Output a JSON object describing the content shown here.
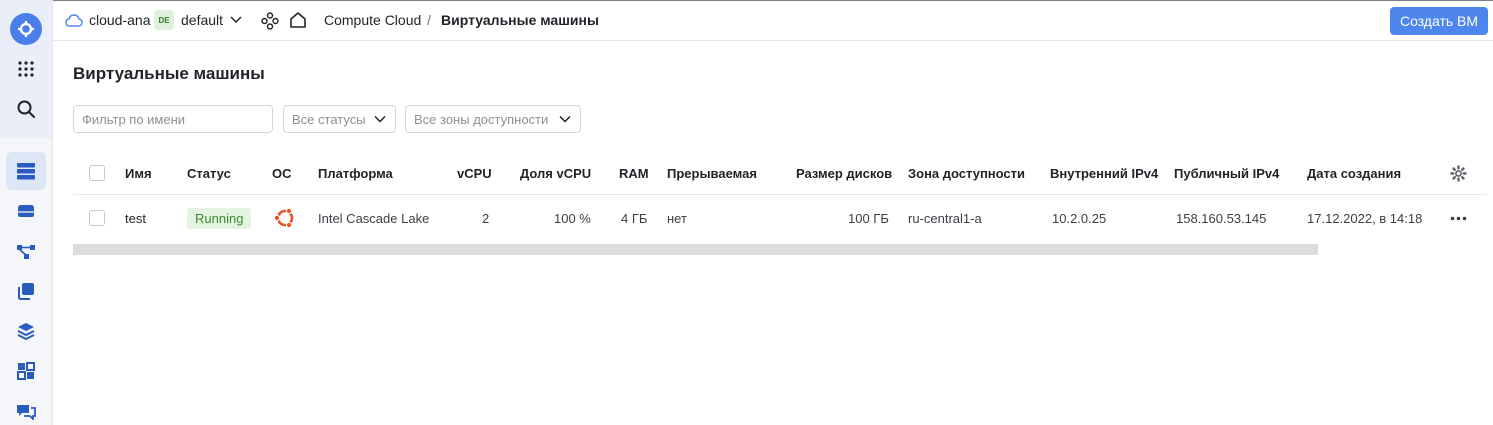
{
  "header": {
    "cloud": "cloud-ana",
    "folder_badge": "DE",
    "folder": "default",
    "service": "Compute Cloud",
    "separator": "/",
    "section": "Виртуальные машины",
    "create_button": "Создать ВМ"
  },
  "page": {
    "title": "Виртуальные машины"
  },
  "filters": {
    "name_placeholder": "Фильтр по имени",
    "status_select": "Все статусы",
    "zone_select": "Все зоны доступности"
  },
  "table": {
    "columns": [
      "Имя",
      "Статус",
      "ОС",
      "Платформа",
      "vCPU",
      "Доля vCPU",
      "RAM",
      "Прерываемая",
      "Размер дисков",
      "Зона доступности",
      "Внутренний IPv4",
      "Публичный IPv4",
      "Дата создания"
    ],
    "rows": [
      {
        "name": "test",
        "status": "Running",
        "os_icon": "ubuntu-icon",
        "platform": "Intel Cascade Lake",
        "vcpu": "2",
        "vcpu_share": "100 %",
        "ram": "4 ГБ",
        "preemptible": "нет",
        "disk_size": "100 ГБ",
        "zone": "ru-central1-a",
        "internal_ip": "10.2.0.25",
        "public_ip": "158.160.53.145",
        "created": "17.12.2022, в 14:18"
      }
    ]
  },
  "colors": {
    "accent": "#4f86ee",
    "running_bg": "#e5f4e1",
    "running_text": "#3b8a2f",
    "ubuntu": "#e95420"
  }
}
